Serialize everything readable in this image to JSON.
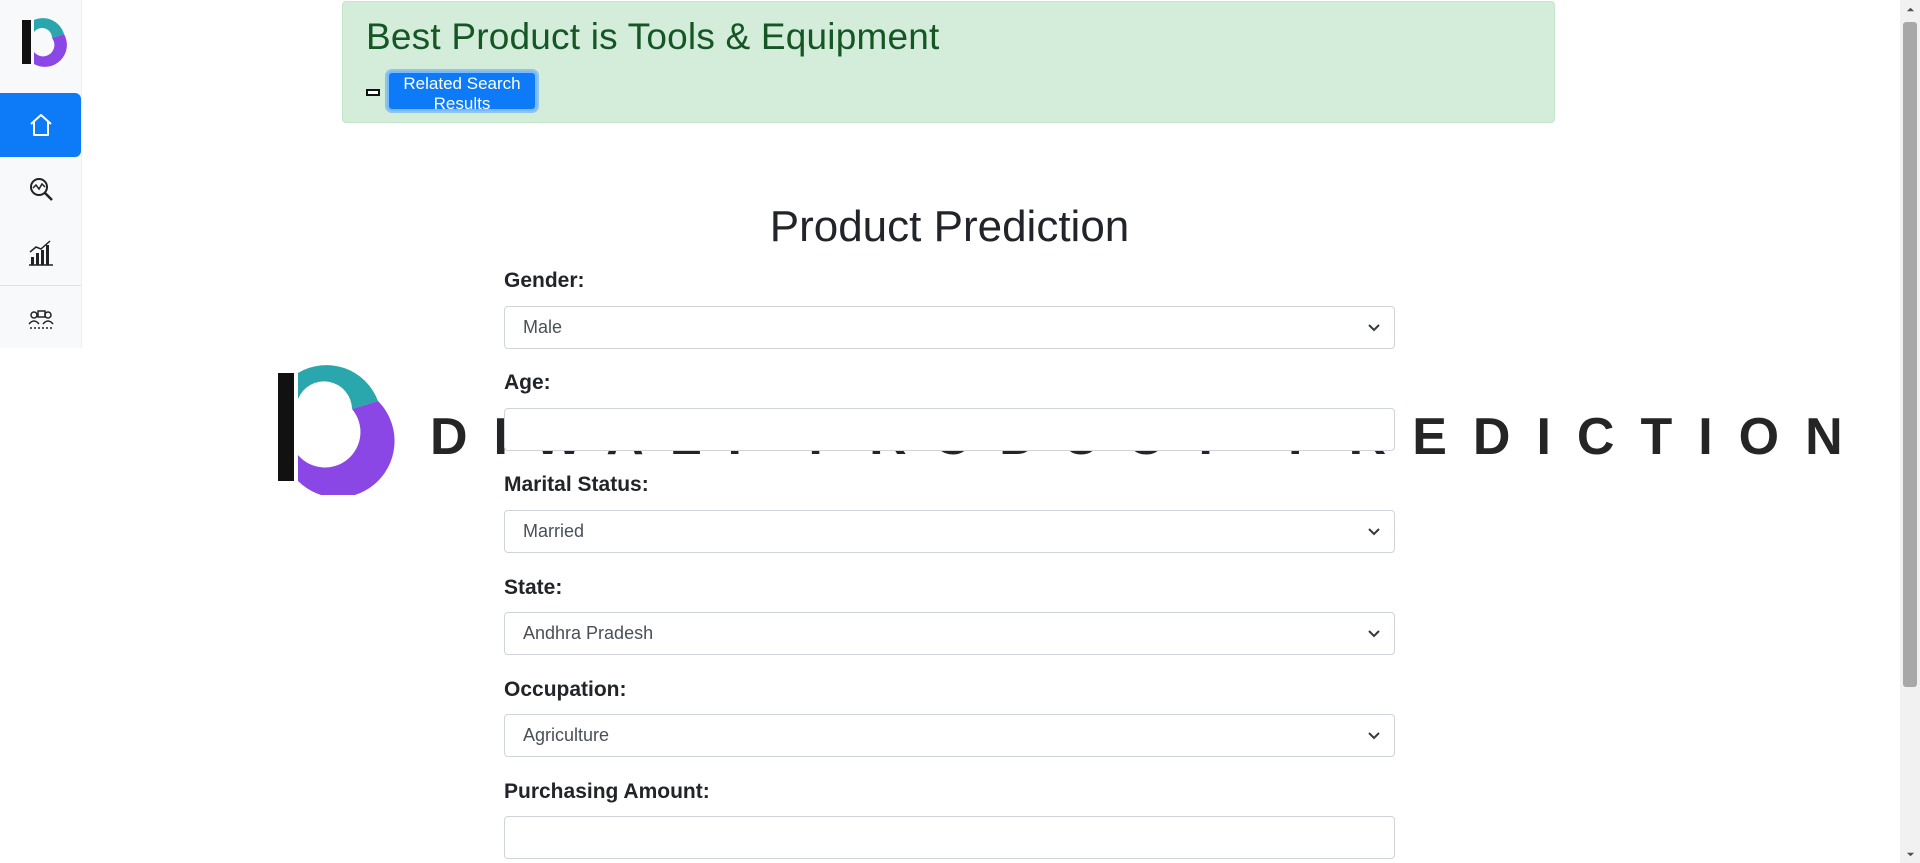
{
  "alert": {
    "message": "Best Product is Tools & Equipment",
    "button_label": "Related Search Results"
  },
  "sidebar": {
    "items": [
      {
        "icon": "home-icon",
        "active": true
      },
      {
        "icon": "search-analytics-icon",
        "active": false
      },
      {
        "icon": "bar-chart-growth-icon",
        "active": false
      },
      {
        "icon": "team-network-icon",
        "active": false
      }
    ]
  },
  "watermark": {
    "text": "DIWALI PRODUCT PREDICTION"
  },
  "form": {
    "title": "Product Prediction",
    "gender": {
      "label": "Gender:",
      "value": "Male"
    },
    "age": {
      "label": "Age:",
      "value": ""
    },
    "marital_status": {
      "label": "Marital Status:",
      "value": "Married"
    },
    "state": {
      "label": "State:",
      "value": "Andhra Pradesh"
    },
    "occupation": {
      "label": "Occupation:",
      "value": "Agriculture"
    },
    "purchasing_amount": {
      "label": "Purchasing Amount:",
      "value": ""
    }
  },
  "colors": {
    "accent": "#0d7bf8",
    "alert_bg": "#d4edda",
    "alert_text": "#155724",
    "logo_teal": "#2aa6ad",
    "logo_purple": "#8b46e6"
  }
}
